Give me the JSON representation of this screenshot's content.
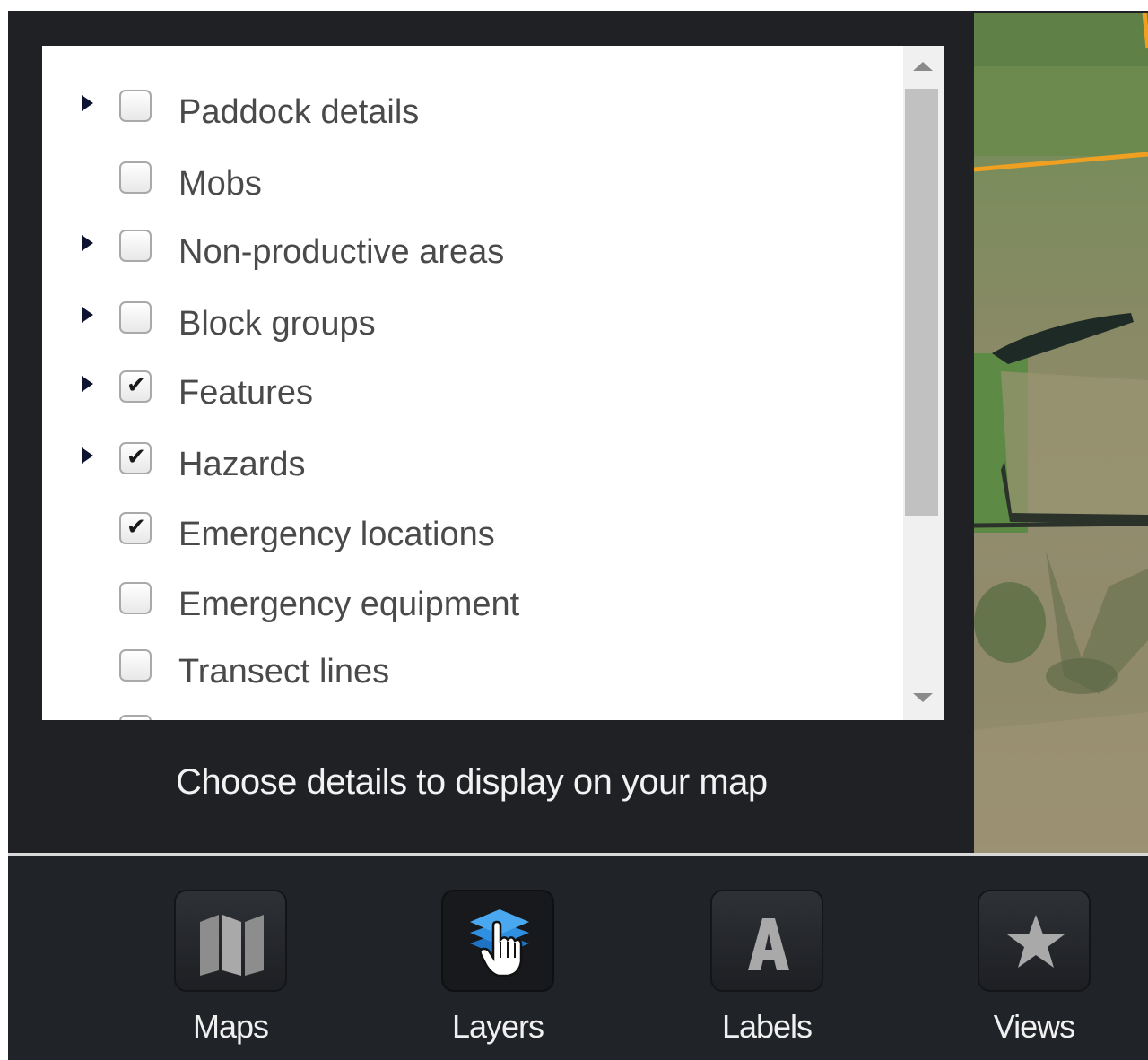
{
  "layers_panel": {
    "items": [
      {
        "label": "Paddock details",
        "checked": false,
        "expandable": true
      },
      {
        "label": "Mobs",
        "checked": false,
        "expandable": false
      },
      {
        "label": "Non-productive areas",
        "checked": false,
        "expandable": true
      },
      {
        "label": "Block groups",
        "checked": false,
        "expandable": true
      },
      {
        "label": "Features",
        "checked": true,
        "expandable": true
      },
      {
        "label": "Hazards",
        "checked": true,
        "expandable": true
      },
      {
        "label": "Emergency locations",
        "checked": true,
        "expandable": false
      },
      {
        "label": "Emergency equipment",
        "checked": false,
        "expandable": false
      },
      {
        "label": "Transect lines",
        "checked": false,
        "expandable": false
      }
    ],
    "hint": "Choose details to display on your map"
  },
  "toolbar": {
    "tools": [
      {
        "label": "Maps",
        "icon": "map-icon",
        "active": false
      },
      {
        "label": "Layers",
        "icon": "layers-icon",
        "active": true
      },
      {
        "label": "Labels",
        "icon": "labels-icon",
        "active": false
      },
      {
        "label": "Views",
        "icon": "star-icon",
        "active": false
      }
    ]
  },
  "colors": {
    "panel_bg": "#1f2125",
    "layers_accent": "#2f8fe0",
    "boundary_line": "#f0a020"
  }
}
